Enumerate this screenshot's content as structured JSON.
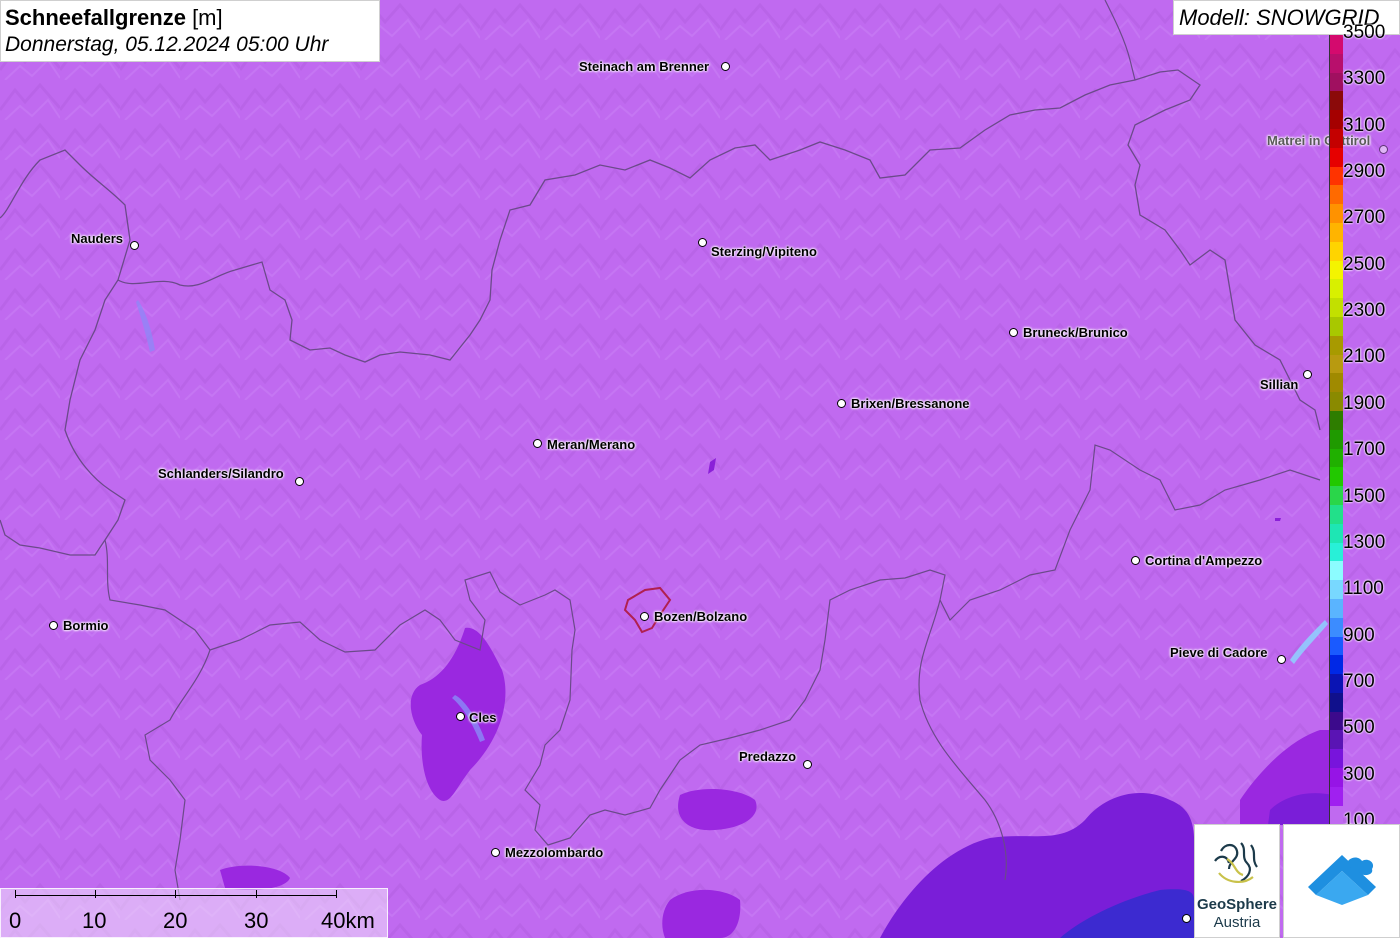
{
  "title": {
    "bold": "Schneefallgrenze",
    "unit": " [m]",
    "datetime": "Donnerstag, 05.12.2024 05:00 Uhr"
  },
  "model": {
    "label": "Modell: SNOWGRID"
  },
  "cities": [
    {
      "name": "Steinach am Brenner"
    },
    {
      "name": "Matrei in Osttirol"
    },
    {
      "name": "Nauders"
    },
    {
      "name": "Sterzing/Vipiteno"
    },
    {
      "name": "Bruneck/Brunico"
    },
    {
      "name": "Sillian"
    },
    {
      "name": "Brixen/Bressanone"
    },
    {
      "name": "Meran/Merano"
    },
    {
      "name": "Schlanders/Silandro"
    },
    {
      "name": "Cortina d'Ampezzo"
    },
    {
      "name": "Bormio"
    },
    {
      "name": "Bozen/Bolzano"
    },
    {
      "name": "Pieve di Cadore"
    },
    {
      "name": "Cles"
    },
    {
      "name": "Predazzo"
    },
    {
      "name": "Mezzolombardo"
    }
  ],
  "legend": {
    "labels": [
      "3500",
      "3300",
      "3100",
      "2900",
      "2700",
      "2500",
      "2300",
      "2100",
      "1900",
      "1700",
      "1500",
      "1300",
      "1100",
      "900",
      "700",
      "500",
      "300",
      "100"
    ],
    "colors": [
      "#d40a6e",
      "#b80f6c",
      "#a01060",
      "#8b0a0a",
      "#a50000",
      "#c40000",
      "#e60000",
      "#ff3300",
      "#ff6a00",
      "#ff9200",
      "#ffb400",
      "#ffd400",
      "#f4f400",
      "#d8f000",
      "#c2e000",
      "#a8c800",
      "#a89a00",
      "#b89a10",
      "#a08a00",
      "#8a8a00",
      "#2e7d00",
      "#1f9a00",
      "#20b000",
      "#22c800",
      "#2ad64a",
      "#22e08a",
      "#1ee6b4",
      "#28f0d8",
      "#8cfcff",
      "#78d8ff",
      "#5ab4ff",
      "#3c8cff",
      "#1a5aff",
      "#0028e6",
      "#0a14b4",
      "#10108c",
      "#3c0a8c",
      "#5a14b4",
      "#7814dc",
      "#9614e6",
      "#a020f0",
      "#c06af0"
    ]
  },
  "scale": {
    "labels": [
      "0",
      "10",
      "20",
      "30",
      "40km"
    ]
  },
  "logos": {
    "geosphere_title": "GeoSphere",
    "geosphere_sub": "Austria"
  },
  "colors": {
    "background": "#c06af0",
    "terrain_shade": "#a95ad8",
    "border": "#6b4a8a",
    "low_snowline": "#9a28e0",
    "very_low_snowline": "#7a1ed8",
    "deep_low": "#5a1ad0",
    "blue_zone": "#3c2ad0",
    "bolzano_outline": "#b02050"
  }
}
